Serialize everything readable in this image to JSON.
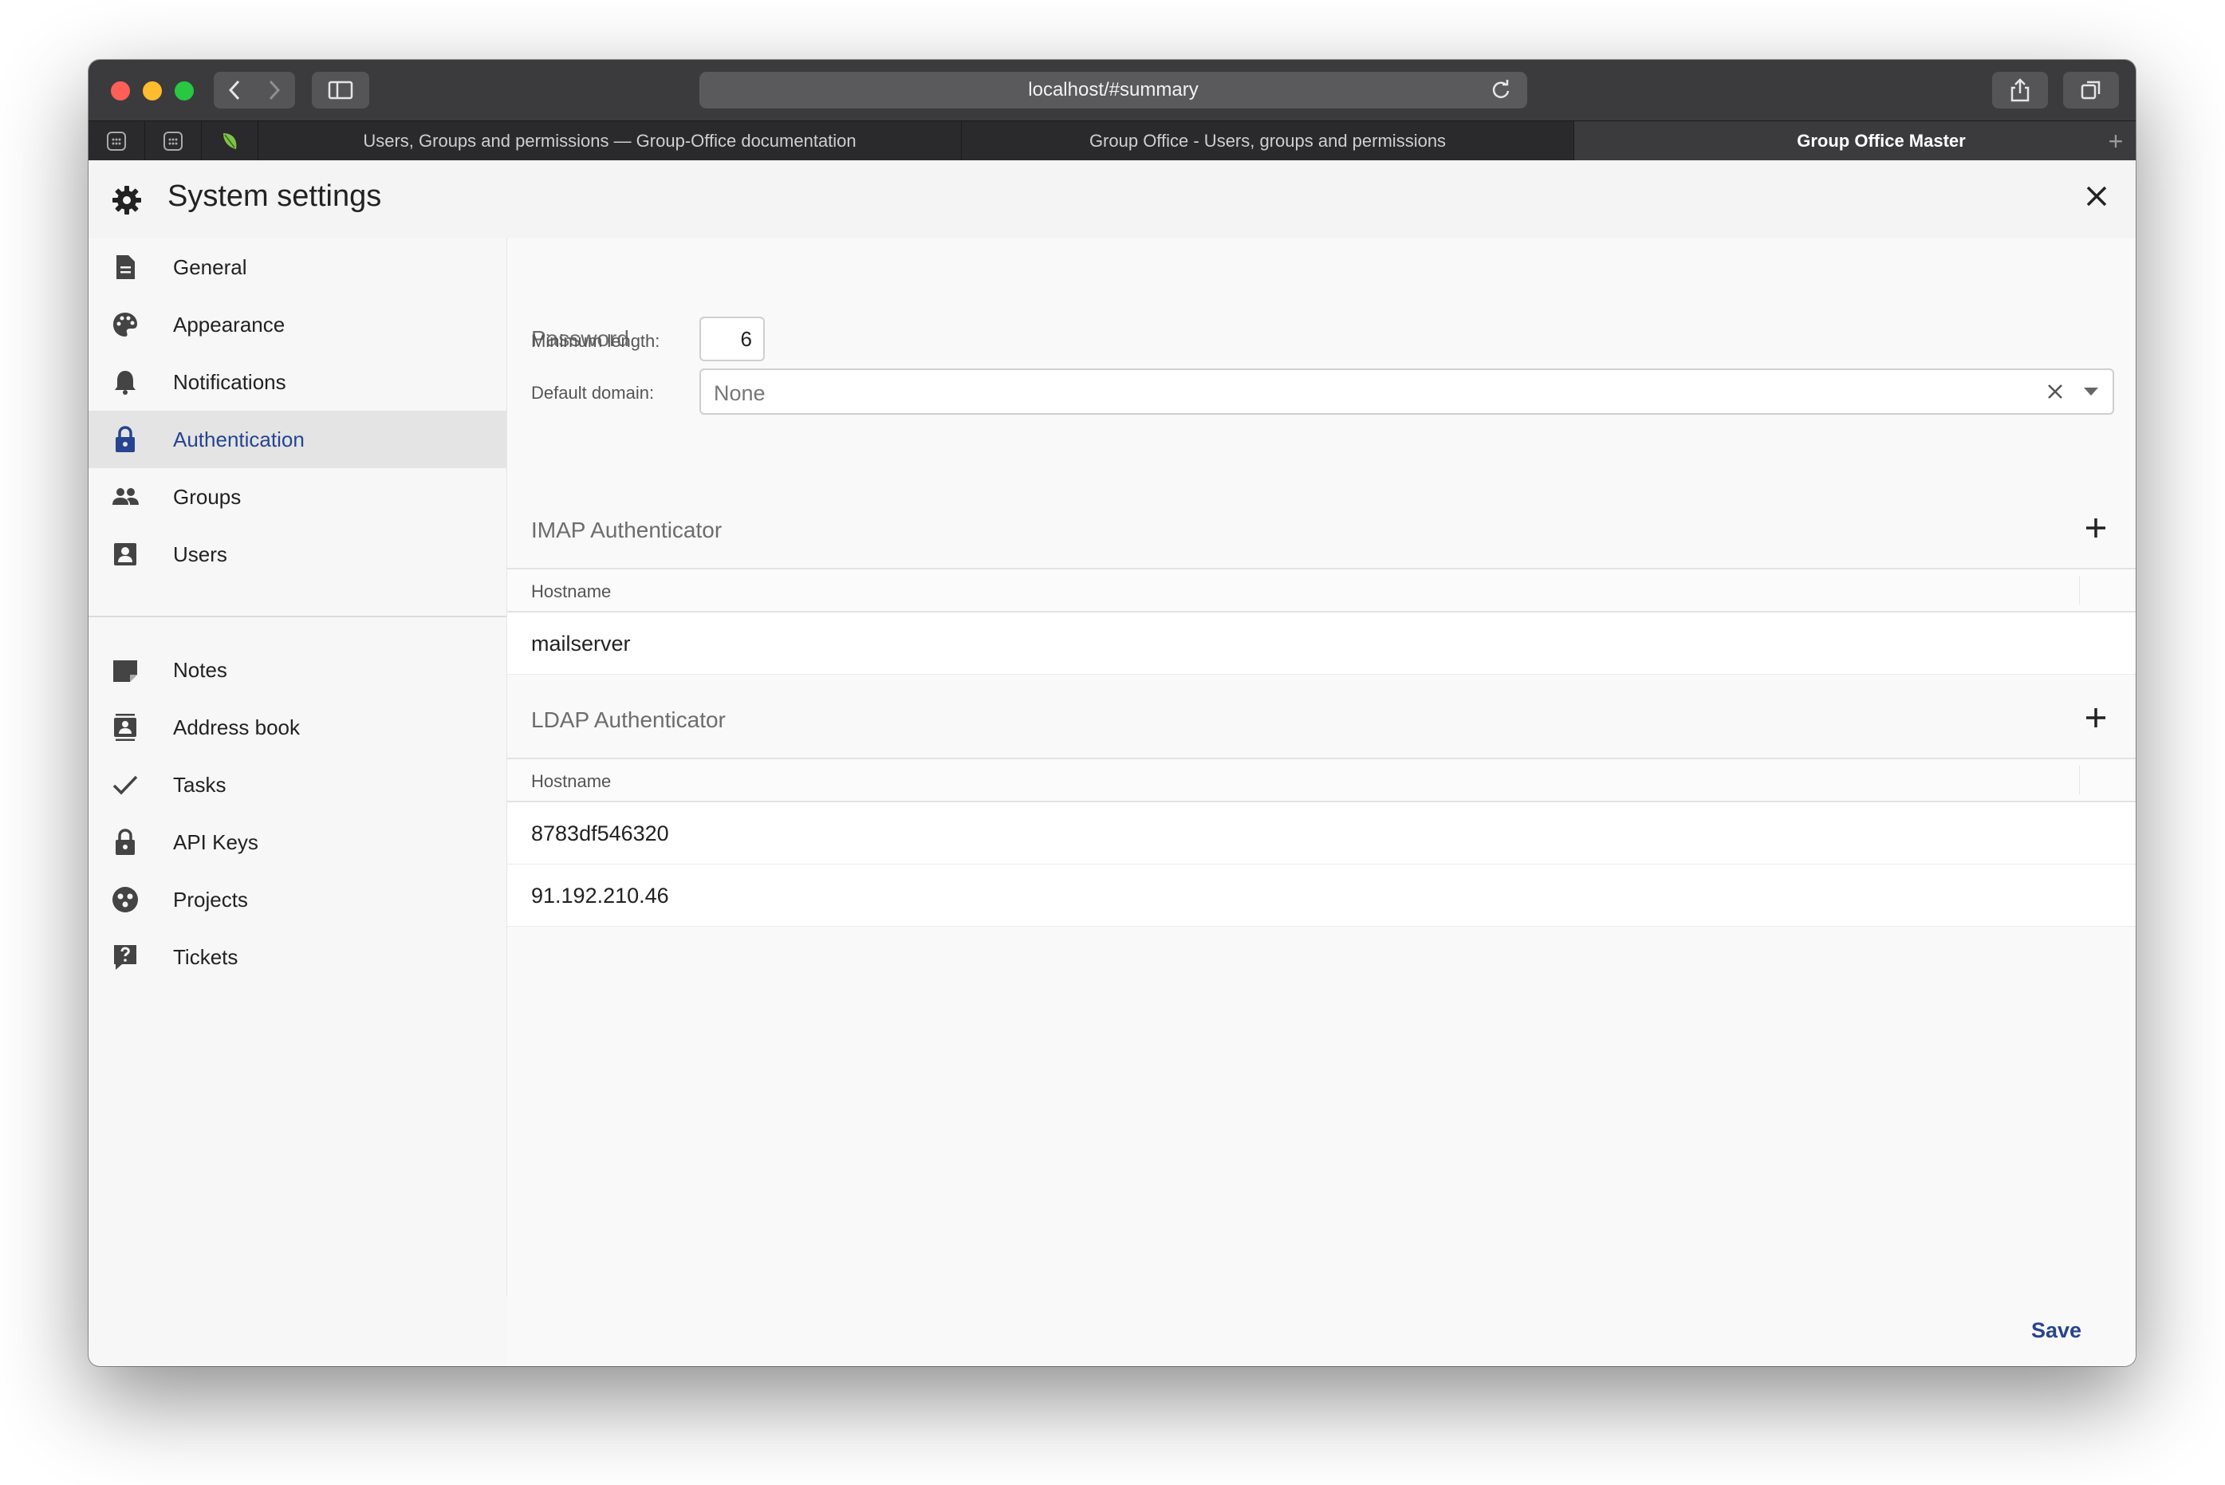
{
  "browser": {
    "url": "localhost/#summary",
    "tabs": [
      {
        "label": "Users, Groups and permissions — Group-Office documentation",
        "active": false
      },
      {
        "label": "Group Office - Users, groups and permissions",
        "active": false
      },
      {
        "label": "Group Office Master",
        "active": true
      }
    ]
  },
  "app": {
    "title": "System settings",
    "icon": "gear-icon"
  },
  "sidebar": {
    "items": [
      {
        "label": "General",
        "icon": "document-icon"
      },
      {
        "label": "Appearance",
        "icon": "palette-icon"
      },
      {
        "label": "Notifications",
        "icon": "bell-icon"
      },
      {
        "label": "Authentication",
        "icon": "lock-icon",
        "active": true
      },
      {
        "label": "Groups",
        "icon": "group-icon"
      },
      {
        "label": "Users",
        "icon": "user-card-icon"
      }
    ],
    "module_items": [
      {
        "label": "Notes",
        "icon": "note-icon"
      },
      {
        "label": "Address book",
        "icon": "address-book-icon"
      },
      {
        "label": "Tasks",
        "icon": "check-icon"
      },
      {
        "label": "API Keys",
        "icon": "lock-icon"
      },
      {
        "label": "Projects",
        "icon": "projects-icon"
      },
      {
        "label": "Tickets",
        "icon": "question-icon"
      }
    ]
  },
  "password": {
    "section_title": "Password",
    "min_length_label": "Minimum length:",
    "min_length_value": "6",
    "default_domain_label": "Default domain:",
    "default_domain_value": "None"
  },
  "imap": {
    "section_title": "IMAP Authenticator",
    "column_header": "Hostname",
    "rows": [
      "mailserver"
    ]
  },
  "ldap": {
    "section_title": "LDAP Authenticator",
    "column_header": "Hostname",
    "rows": [
      "8783df546320",
      "91.192.210.46"
    ]
  },
  "footer": {
    "save_label": "Save"
  },
  "colors": {
    "accent": "#26448f",
    "titlebar": "#3b3b3d"
  }
}
